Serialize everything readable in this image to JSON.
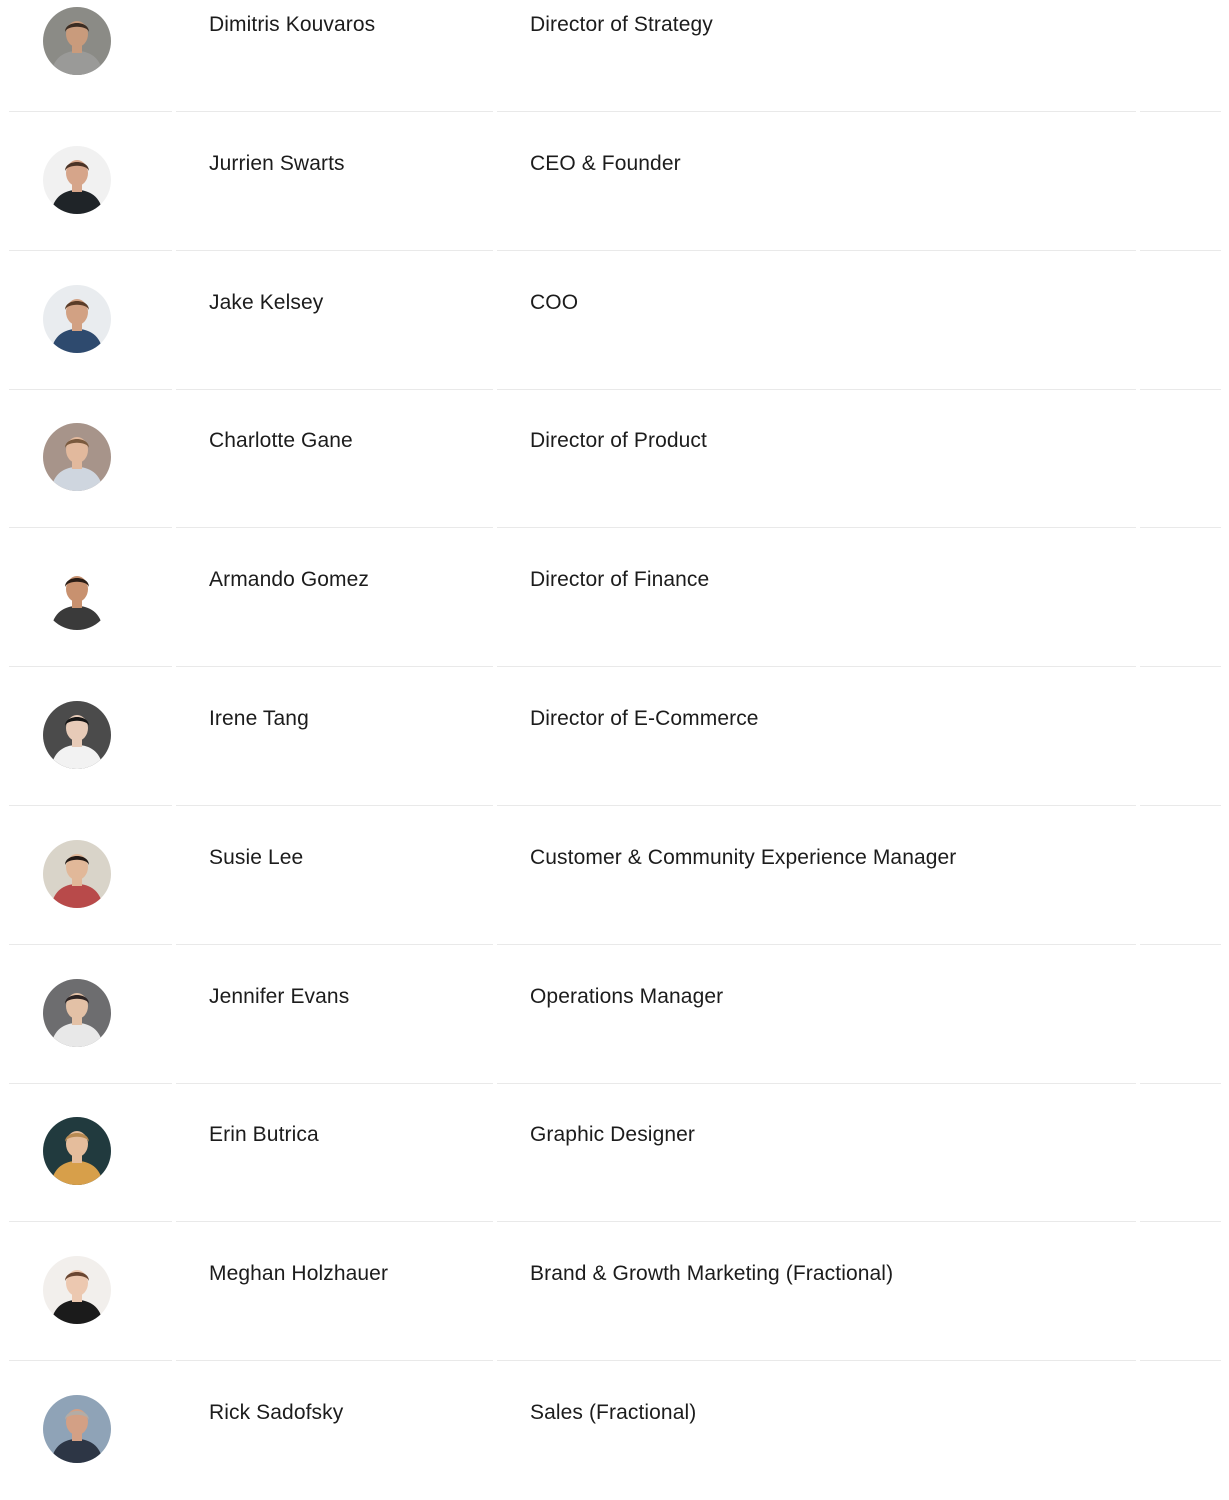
{
  "team": {
    "members": [
      {
        "name": "Dimitris Kouvaros",
        "role": "Director of Strategy",
        "avatar": {
          "icon": "person-photo-avatar",
          "bg": "#8b8b86",
          "skin": "#c99b7c",
          "hair": "#3b2c22",
          "shirt": "#9a9a98"
        }
      },
      {
        "name": "Jurrien Swarts",
        "role": "CEO & Founder",
        "avatar": {
          "icon": "person-photo-avatar",
          "bg": "#f1f1f1",
          "skin": "#d6a58a",
          "hair": "#4a3326",
          "shirt": "#1f2428"
        }
      },
      {
        "name": "Jake Kelsey",
        "role": "COO",
        "avatar": {
          "icon": "person-photo-avatar",
          "bg": "#e9ecef",
          "skin": "#d2a183",
          "hair": "#5a3c28",
          "shirt": "#2e4a6e"
        }
      },
      {
        "name": "Charlotte Gane",
        "role": "Director of Product",
        "avatar": {
          "icon": "person-photo-avatar",
          "bg": "#a7948a",
          "skin": "#e2b99d",
          "hair": "#7a5a3e",
          "shirt": "#cfd6df"
        }
      },
      {
        "name": "Armando Gomez",
        "role": "Director of Finance",
        "avatar": {
          "icon": "person-photo-avatar",
          "bg": "#ffffff",
          "skin": "#c8916f",
          "hair": "#2a1d16",
          "shirt": "#3a3a3a"
        }
      },
      {
        "name": "Irene Tang",
        "role": "Director of E-Commerce",
        "avatar": {
          "icon": "person-photo-avatar",
          "bg": "#4b4b4b",
          "skin": "#e7cbb8",
          "hair": "#151515",
          "shirt": "#f2f2f2"
        }
      },
      {
        "name": "Susie Lee",
        "role": "Customer & Community Experience Manager",
        "avatar": {
          "icon": "person-photo-avatar",
          "bg": "#d9d4c9",
          "skin": "#e1b899",
          "hair": "#231a16",
          "shirt": "#b84a4a"
        }
      },
      {
        "name": "Jennifer Evans",
        "role": "Operations Manager",
        "avatar": {
          "icon": "person-photo-avatar",
          "bg": "#6d6d6f",
          "skin": "#e3c1a6",
          "hair": "#2c2322",
          "shirt": "#e8e8e8"
        }
      },
      {
        "name": "Erin Butrica",
        "role": "Graphic Designer",
        "avatar": {
          "icon": "person-photo-avatar",
          "bg": "#213a3e",
          "skin": "#e5bd9c",
          "hair": "#b88a52",
          "shirt": "#d79f4a"
        }
      },
      {
        "name": "Meghan Holzhauer",
        "role": "Brand & Growth Marketing (Fractional)",
        "avatar": {
          "icon": "person-photo-avatar",
          "bg": "#f2efec",
          "skin": "#ecc8b0",
          "hair": "#6a4631",
          "shirt": "#1b1b1b"
        }
      },
      {
        "name": "Rick Sadofsky",
        "role": "Sales (Fractional)",
        "avatar": {
          "icon": "person-photo-avatar",
          "bg": "#8fa3b7",
          "skin": "#d3a085",
          "hair": "#b3aca6",
          "shirt": "#2d3645"
        }
      }
    ]
  }
}
